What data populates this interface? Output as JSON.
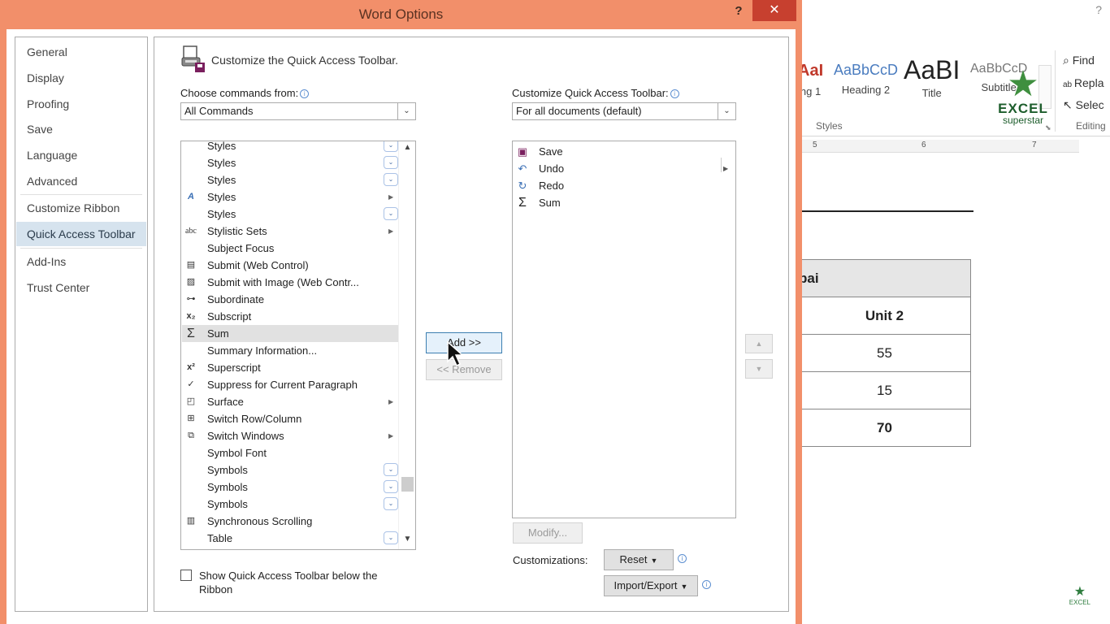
{
  "dialog": {
    "title": "Word Options",
    "help": "?",
    "close": "✕",
    "nav": [
      {
        "label": "General"
      },
      {
        "label": "Display"
      },
      {
        "label": "Proofing"
      },
      {
        "label": "Save"
      },
      {
        "label": "Language"
      },
      {
        "label": "Advanced"
      },
      {
        "label": "Customize Ribbon"
      },
      {
        "label": "Quick Access Toolbar"
      },
      {
        "label": "Add-Ins"
      },
      {
        "label": "Trust Center"
      }
    ],
    "section_title": "Customize the Quick Access Toolbar.",
    "choose_label": "Choose commands from:",
    "choose_value": "All Commands",
    "customize_label": "Customize Quick Access Toolbar:",
    "customize_value": "For all documents (default)",
    "commands": [
      {
        "label": "Styles"
      },
      {
        "label": "Styles"
      },
      {
        "label": "Styles"
      },
      {
        "label": "Styles"
      },
      {
        "label": "Styles"
      },
      {
        "label": "Stylistic Sets"
      },
      {
        "label": "Subject Focus"
      },
      {
        "label": "Submit (Web Control)"
      },
      {
        "label": "Submit with Image (Web Contr..."
      },
      {
        "label": "Subordinate"
      },
      {
        "label": "Subscript"
      },
      {
        "label": "Sum"
      },
      {
        "label": "Summary Information..."
      },
      {
        "label": "Superscript"
      },
      {
        "label": "Suppress for Current Paragraph"
      },
      {
        "label": "Surface"
      },
      {
        "label": "Switch Row/Column"
      },
      {
        "label": "Switch Windows"
      },
      {
        "label": "Symbol Font"
      },
      {
        "label": "Symbols"
      },
      {
        "label": "Symbols"
      },
      {
        "label": "Symbols"
      },
      {
        "label": "Synchronous Scrolling"
      },
      {
        "label": "Table"
      }
    ],
    "qat_items": [
      {
        "label": "Save"
      },
      {
        "label": "Undo"
      },
      {
        "label": "Redo"
      },
      {
        "label": "Sum"
      }
    ],
    "add_button": "Add >>",
    "remove_button": "<< Remove",
    "modify_button": "Modify...",
    "customizations_label": "Customizations:",
    "reset_button": "Reset",
    "import_export_button": "Import/Export",
    "show_below_label": "Show Quick Access Toolbar below the Ribbon"
  },
  "word": {
    "help": "?",
    "styles": [
      {
        "sample": "AaI",
        "name": "ng 1"
      },
      {
        "sample": "AaBbCcD",
        "name": "Heading 2"
      },
      {
        "sample": "AaBI",
        "name": "Title"
      },
      {
        "sample": "AaBbCcD",
        "name": "Subtitle"
      }
    ],
    "styles_group": "Styles",
    "editing": {
      "find": "Find",
      "replace": "Repla",
      "select": "Selec",
      "group": "Editing"
    },
    "logo": {
      "line1": "EXCEL",
      "line2": "superstar",
      "small": "EXCEL"
    },
    "ruler": [
      "5",
      "6",
      "7"
    ],
    "table": {
      "header": "bai",
      "subheader": "Unit 2",
      "rows": [
        "55",
        "15",
        "70"
      ]
    }
  },
  "colors": {
    "dialog_frame": "#f28f6a",
    "close_button": "#c7402f",
    "nav_active": "#d6e3ee",
    "selected_row": "#e1e1e1"
  }
}
